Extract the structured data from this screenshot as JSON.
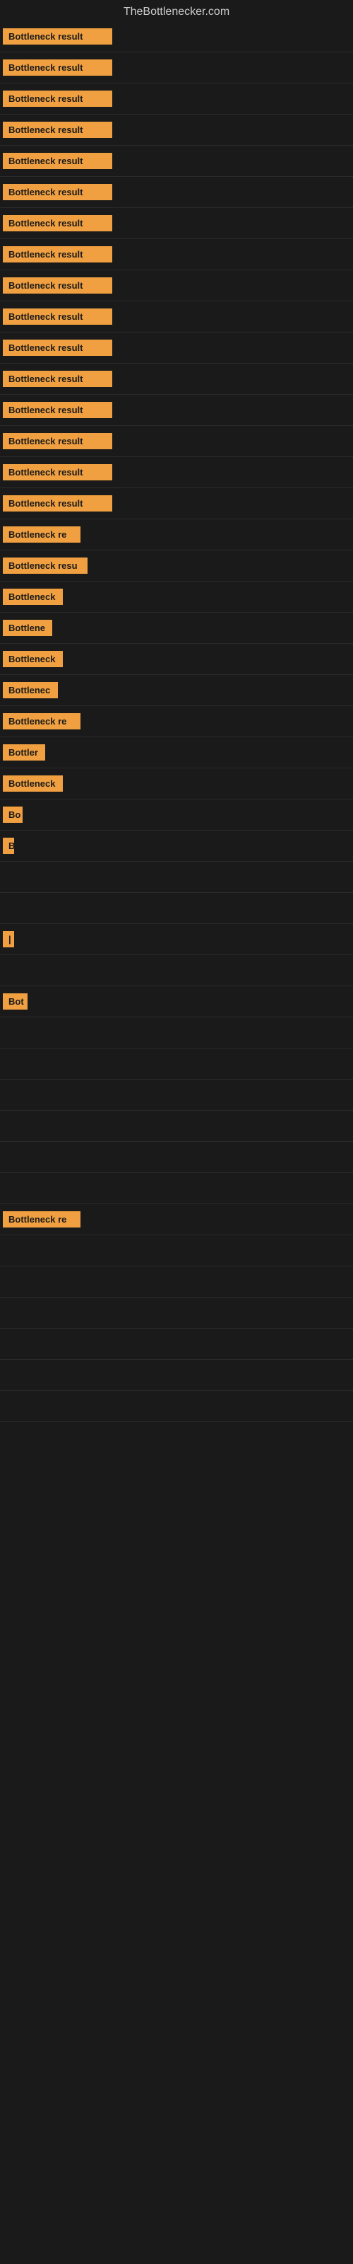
{
  "site": {
    "title": "TheBottlenecker.com"
  },
  "rows": [
    {
      "id": 1,
      "badge": "Bottleneck result",
      "badge_width": 155
    },
    {
      "id": 2,
      "badge": "Bottleneck result",
      "badge_width": 155
    },
    {
      "id": 3,
      "badge": "Bottleneck result",
      "badge_width": 155
    },
    {
      "id": 4,
      "badge": "Bottleneck result",
      "badge_width": 155
    },
    {
      "id": 5,
      "badge": "Bottleneck result",
      "badge_width": 155
    },
    {
      "id": 6,
      "badge": "Bottleneck result",
      "badge_width": 155
    },
    {
      "id": 7,
      "badge": "Bottleneck result",
      "badge_width": 155
    },
    {
      "id": 8,
      "badge": "Bottleneck result",
      "badge_width": 155
    },
    {
      "id": 9,
      "badge": "Bottleneck result",
      "badge_width": 155
    },
    {
      "id": 10,
      "badge": "Bottleneck result",
      "badge_width": 155
    },
    {
      "id": 11,
      "badge": "Bottleneck result",
      "badge_width": 155
    },
    {
      "id": 12,
      "badge": "Bottleneck result",
      "badge_width": 155
    },
    {
      "id": 13,
      "badge": "Bottleneck result",
      "badge_width": 155
    },
    {
      "id": 14,
      "badge": "Bottleneck result",
      "badge_width": 155
    },
    {
      "id": 15,
      "badge": "Bottleneck result",
      "badge_width": 155
    },
    {
      "id": 16,
      "badge": "Bottleneck result",
      "badge_width": 155
    },
    {
      "id": 17,
      "badge": "Bottleneck re",
      "badge_width": 110
    },
    {
      "id": 18,
      "badge": "Bottleneck resu",
      "badge_width": 120
    },
    {
      "id": 19,
      "badge": "Bottleneck",
      "badge_width": 85
    },
    {
      "id": 20,
      "badge": "Bottlene",
      "badge_width": 70
    },
    {
      "id": 21,
      "badge": "Bottleneck",
      "badge_width": 85
    },
    {
      "id": 22,
      "badge": "Bottlenec",
      "badge_width": 78
    },
    {
      "id": 23,
      "badge": "Bottleneck re",
      "badge_width": 110
    },
    {
      "id": 24,
      "badge": "Bottler",
      "badge_width": 60
    },
    {
      "id": 25,
      "badge": "Bottleneck",
      "badge_width": 85
    },
    {
      "id": 26,
      "badge": "Bo",
      "badge_width": 28
    },
    {
      "id": 27,
      "badge": "B",
      "badge_width": 16
    },
    {
      "id": 28,
      "badge": "",
      "badge_width": 0
    },
    {
      "id": 29,
      "badge": "",
      "badge_width": 0
    },
    {
      "id": 30,
      "badge": "|",
      "badge_width": 8
    },
    {
      "id": 31,
      "badge": "",
      "badge_width": 0
    },
    {
      "id": 32,
      "badge": "Bot",
      "badge_width": 35
    },
    {
      "id": 33,
      "badge": "",
      "badge_width": 0
    },
    {
      "id": 34,
      "badge": "",
      "badge_width": 0
    },
    {
      "id": 35,
      "badge": "",
      "badge_width": 0
    },
    {
      "id": 36,
      "badge": "",
      "badge_width": 0
    },
    {
      "id": 37,
      "badge": "",
      "badge_width": 0
    },
    {
      "id": 38,
      "badge": "",
      "badge_width": 0
    },
    {
      "id": 39,
      "badge": "Bottleneck re",
      "badge_width": 110
    },
    {
      "id": 40,
      "badge": "",
      "badge_width": 0
    },
    {
      "id": 41,
      "badge": "",
      "badge_width": 0
    },
    {
      "id": 42,
      "badge": "",
      "badge_width": 0
    },
    {
      "id": 43,
      "badge": "",
      "badge_width": 0
    },
    {
      "id": 44,
      "badge": "",
      "badge_width": 0
    },
    {
      "id": 45,
      "badge": "",
      "badge_width": 0
    }
  ],
  "colors": {
    "badge_bg": "#f0a040",
    "badge_text": "#1a1a1a",
    "bg": "#1a1a1a",
    "title": "#cccccc"
  }
}
